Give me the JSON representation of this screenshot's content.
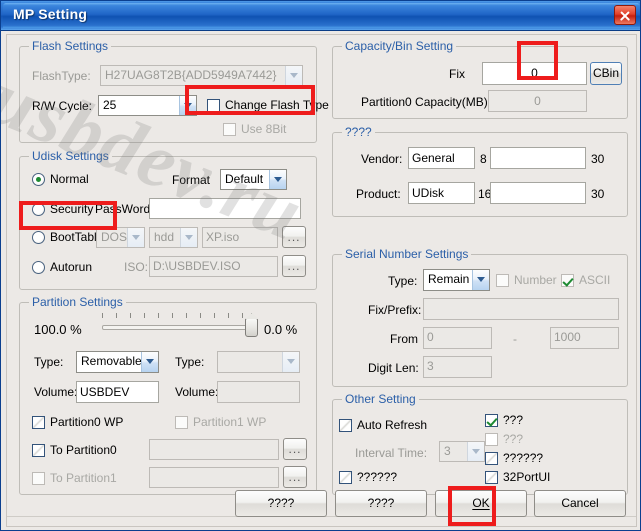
{
  "window": {
    "title": "MP Setting",
    "close_icon": "close-icon",
    "watermark": "usbdev.ru",
    "accent_color": "#1f64c6",
    "annotation_color": "#ee1c1c"
  },
  "flash_settings": {
    "title": "Flash Settings",
    "flash_type_label": "FlashType:",
    "flash_type_value": "H27UAG8T2B{ADD5949A7442}",
    "rw_cycle_label": "R/W Cycle:",
    "rw_cycle_value": "25",
    "change_flash_type_label": "Change Flash Type",
    "change_flash_type_checked": false,
    "use_8bit_label": "Use 8Bit",
    "use_8bit_checked": false
  },
  "udisk_settings": {
    "title": "Udisk Settings",
    "normal_label": "Normal",
    "security_label": "Security",
    "boottable_label": "BootTable",
    "autorun_label": "Autorun",
    "selected_mode": "Normal",
    "format_label": "Format",
    "format_value": "Default",
    "password_label": "PassWord:",
    "password_value": "",
    "boot_os_value": "DOS",
    "boot_dev_value": "hdd",
    "boot_iso_value": "XP.iso",
    "boot_browse_label": "...",
    "iso_label": "ISO:",
    "iso_value": "D:\\USBDEV.ISO",
    "iso_browse_label": "..."
  },
  "partition_settings": {
    "title": "Partition Settings",
    "left_percent": "100.0 %",
    "right_percent": "0.0 %",
    "slider_value": 100,
    "type_label": "Type:",
    "type0_value": "Removable",
    "type1_value": "",
    "volume_label": "Volume:",
    "volume0_value": "USBDEV",
    "volume1_value": "",
    "partition0_wp_label": "Partition0 WP",
    "partition0_wp_checked": false,
    "partition1_wp_label": "Partition1 WP",
    "partition1_wp_checked": false,
    "to_partition0_label": "To Partition0",
    "to_partition0_checked": false,
    "to_partition0_path": "",
    "to_partition0_browse": "...",
    "to_partition1_label": "To Partition1",
    "to_partition1_checked": false,
    "to_partition1_path": "",
    "to_partition1_browse": "..."
  },
  "capacity_bin": {
    "title": "Capacity/Bin Setting",
    "fix_label": "Fix",
    "fix_value": "0",
    "cbin_label": "CBin",
    "partition0_capacity_label": "Partition0 Capacity(MB):",
    "partition0_capacity_value": "0"
  },
  "vendor_group": {
    "title": "????",
    "vendor_label": "Vendor:",
    "vendor_value": "General",
    "vendor_len": "8",
    "vendor_extra_value": "",
    "vendor_extra_len": "30",
    "product_label": "Product:",
    "product_value": "UDisk",
    "product_len": "16",
    "product_extra_value": "",
    "product_extra_len": "30"
  },
  "serial_settings": {
    "title": "Serial Number Settings",
    "type_label": "Type:",
    "type_value": "Remain",
    "number_label": "Number",
    "number_checked": false,
    "ascii_label": "ASCII",
    "ascii_checked": true,
    "fix_prefix_label": "Fix/Prefix:",
    "fix_prefix_value": "",
    "from_label": "From",
    "from_value": "0",
    "range_dash": "-",
    "to_value": "1000",
    "digit_len_label": "Digit Len:",
    "digit_len_value": "3"
  },
  "other_settings": {
    "title": "Other Setting",
    "auto_refresh_label": "Auto Refresh",
    "auto_refresh_checked": false,
    "interval_time_label": "Interval Time:",
    "interval_time_value": "3",
    "unknown_left_label": "??????",
    "unknown_left_checked": false,
    "opt1_label": "???",
    "opt1_checked": true,
    "opt2_label": "???",
    "opt2_checked": false,
    "opt3_label": "??????",
    "opt3_checked": false,
    "opt4_label": "32PortUI",
    "opt4_checked": false
  },
  "footer": {
    "button1_label": "????",
    "button2_label": "????",
    "ok_label": "OK",
    "cancel_label": "Cancel"
  }
}
